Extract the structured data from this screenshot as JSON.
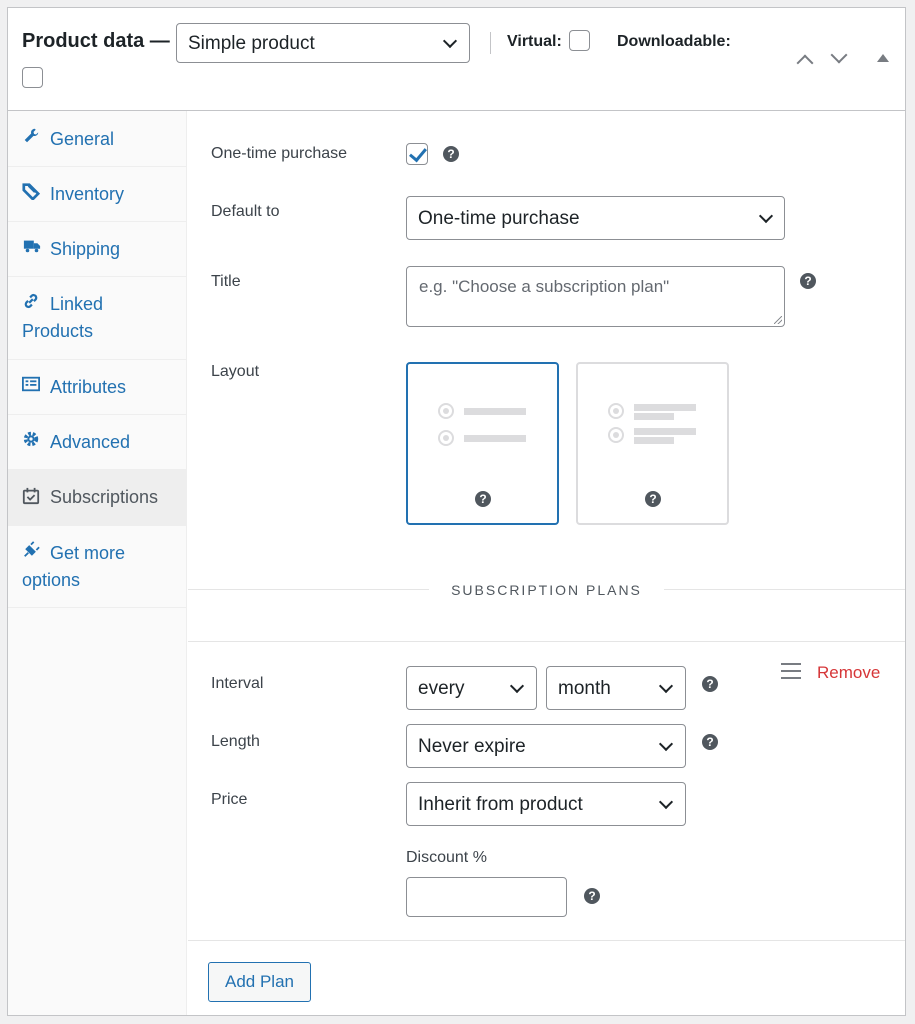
{
  "header": {
    "title": "Product data —",
    "product_type": "Simple product",
    "virtual_label": "Virtual:",
    "downloadable_label": "Downloadable:",
    "virtual_checked": false,
    "downloadable_checked": false
  },
  "sidebar": {
    "items": [
      {
        "label": "General",
        "icon": "wrench-icon",
        "active": false
      },
      {
        "label": "Inventory",
        "icon": "tag-icon",
        "active": false
      },
      {
        "label": "Shipping",
        "icon": "truck-icon",
        "active": false
      },
      {
        "label": "Linked Products",
        "icon": "link-icon",
        "active": false
      },
      {
        "label": "Attributes",
        "icon": "list-icon",
        "active": false
      },
      {
        "label": "Advanced",
        "icon": "gear-icon",
        "active": false
      },
      {
        "label": "Subscriptions",
        "icon": "calendar-check-icon",
        "active": true
      },
      {
        "label": "Get more options",
        "icon": "plugin-icon",
        "active": false
      }
    ]
  },
  "form": {
    "one_time_label": "One-time purchase",
    "one_time_checked": true,
    "default_to_label": "Default to",
    "default_to_value": "One-time purchase",
    "title_label": "Title",
    "title_placeholder": "e.g. \"Choose a subscription plan\"",
    "layout_label": "Layout",
    "help_glyph": "?"
  },
  "plans": {
    "section_title": "SUBSCRIPTION PLANS",
    "remove_label": "Remove",
    "interval_label": "Interval",
    "interval_every": "every",
    "interval_unit": "month",
    "length_label": "Length",
    "length_value": "Never expire",
    "price_label": "Price",
    "price_value": "Inherit from product",
    "discount_label": "Discount %",
    "discount_value": "",
    "add_plan_label": "Add Plan"
  },
  "colors": {
    "accent": "#2271b1",
    "danger": "#d63638",
    "sidebar_bg": "#fafafa"
  }
}
